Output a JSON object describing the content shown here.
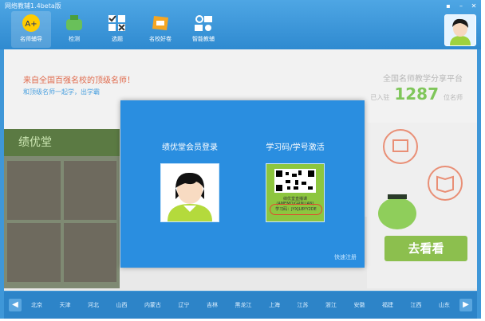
{
  "app": {
    "title": "网络教辅1.4beta版",
    "window_controls": [
      "▪",
      "–",
      "✕"
    ]
  },
  "nav": {
    "items": [
      {
        "label": "名师辅导",
        "icon": "teacher-a-plus-icon",
        "active": true
      },
      {
        "label": "检测",
        "icon": "exam-cap-icon",
        "active": false
      },
      {
        "label": "选题",
        "icon": "checklist-icon",
        "active": false
      },
      {
        "label": "名校好卷",
        "icon": "book-icon",
        "active": false
      },
      {
        "label": "智能教辅",
        "icon": "smart-tutor-icon",
        "active": false
      }
    ]
  },
  "banner": {
    "headline": "来自全国百强名校的顶级名师！",
    "subline": "和顶级名师一起学，出学霸",
    "stat_title": "全国名师教学分享平台",
    "stat_prefix": "已入驻",
    "stat_count": "1287",
    "stat_suffix": "位名师",
    "go_label": "去看看"
  },
  "photo_panel": {
    "logo_text": "绩优堂"
  },
  "modal": {
    "member_login_label": "绩优堂会员登录",
    "activate_label": "学习码/学号激活",
    "qr_line": "绩优堂直播课 (AMEMO/GRNLIAN)",
    "qr_code_text": "学习码：JYXJLBYY2DE",
    "quick_register": "快速注册"
  },
  "status_bar": {
    "provinces": [
      "北京",
      "天津",
      "河北",
      "山西",
      "内蒙古",
      "辽宁",
      "吉林",
      "黑龙江",
      "上海",
      "江苏",
      "浙江",
      "安徽",
      "福建",
      "江西",
      "山东"
    ],
    "prev_label": "◀",
    "next_label": "▶"
  },
  "colors": {
    "primary_blue": "#2a8ee0",
    "accent_green": "#7fc65a",
    "accent_red": "#e06a4c"
  }
}
